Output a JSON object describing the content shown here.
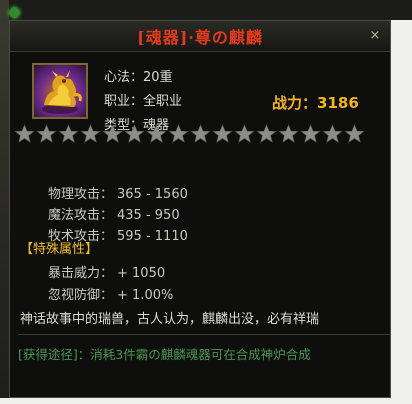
{
  "title": "[魂器]·尊の麒麟",
  "close_label": "×",
  "attributes": {
    "method": "心法：20重",
    "class": "职业：全职业",
    "type": "类型：魂器"
  },
  "power": {
    "label": "战力：",
    "value": "3186"
  },
  "stars": {
    "count": 16,
    "filled": 0
  },
  "stats": [
    {
      "label": "物理攻击：",
      "value": "365 - 1560"
    },
    {
      "label": "魔法攻击：",
      "value": "435 - 950"
    },
    {
      "label": "牧术攻击：",
      "value": "595 - 1110"
    }
  ],
  "special": {
    "header": "【特殊属性】",
    "items": [
      {
        "label": "暴击威力：",
        "value": "+ 1050"
      },
      {
        "label": "忽视防御：",
        "value": "+ 1.00%"
      }
    ]
  },
  "description": "神话故事中的瑞兽，古人认为，麒麟出没，必有祥瑞",
  "source": "[获得途径]：消耗3件霸の麒麟魂器可在合成神炉合成",
  "colors": {
    "title": "#e23a1a",
    "power": "#f5b418",
    "special_header": "#f0c020",
    "source": "#4a9650",
    "star": "#8d8d8d"
  },
  "icons": {
    "item": "golden-qilin-icon",
    "star": "star-icon",
    "gem": "green-gem-icon"
  }
}
